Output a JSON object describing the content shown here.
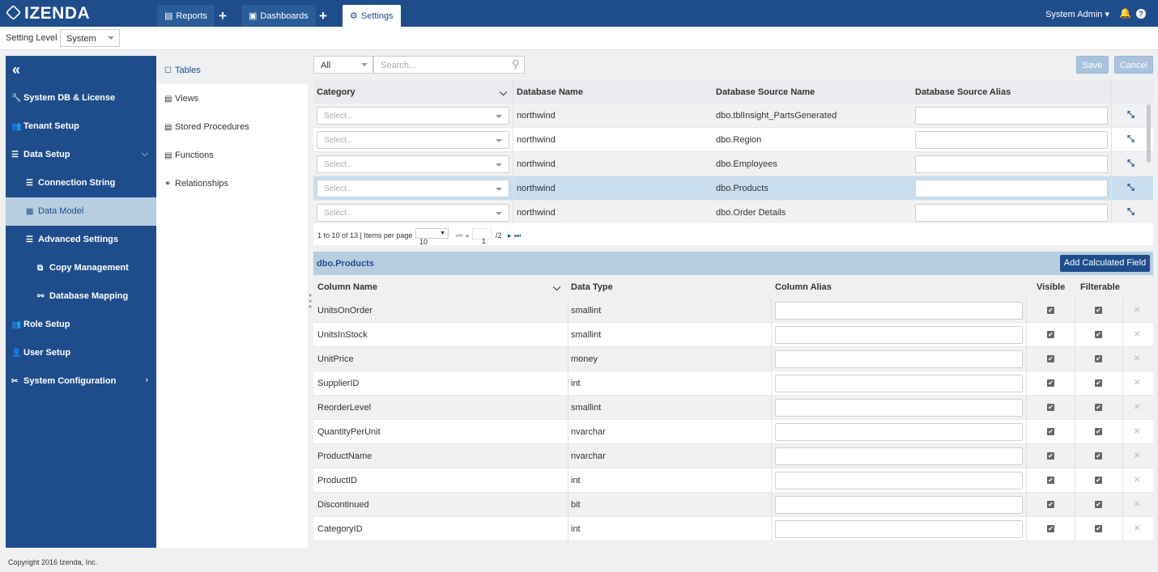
{
  "app": {
    "logo": "IZENDA",
    "tabs": [
      {
        "label": "Reports",
        "icon": "reports-icon"
      },
      {
        "label": "Dashboards",
        "icon": "dashboards-icon"
      },
      {
        "label": "Settings",
        "icon": "gear-icon"
      }
    ],
    "user": "System Admin"
  },
  "setting_level": {
    "label": "Setting Level",
    "value": "System"
  },
  "sidebar": {
    "items": [
      {
        "label": "System DB & License",
        "icon": "wrench-icon"
      },
      {
        "label": "Tenant Setup",
        "icon": "users-icon"
      },
      {
        "label": "Data Setup",
        "icon": "data-setup-icon"
      },
      {
        "label": "Connection String",
        "icon": "connection-icon"
      },
      {
        "label": "Data Model",
        "icon": "grid-icon"
      },
      {
        "label": "Advanced Settings",
        "icon": "advanced-icon"
      },
      {
        "label": "Copy Management",
        "icon": "copy-icon"
      },
      {
        "label": "Database Mapping",
        "icon": "mapping-icon"
      },
      {
        "label": "Role Setup",
        "icon": "users-icon"
      },
      {
        "label": "User Setup",
        "icon": "user-icon"
      },
      {
        "label": "System Configuration",
        "icon": "tools-icon"
      }
    ]
  },
  "subnav": {
    "items": [
      {
        "label": "Tables",
        "icon": "table-icon"
      },
      {
        "label": "Views",
        "icon": "view-icon"
      },
      {
        "label": "Stored Procedures",
        "icon": "procedure-icon"
      },
      {
        "label": "Functions",
        "icon": "function-icon"
      },
      {
        "label": "Relationships",
        "icon": "link-icon"
      }
    ]
  },
  "toolbar": {
    "filter_value": "All",
    "search_placeholder": "Search...",
    "save": "Save",
    "cancel": "Cancel"
  },
  "tables_grid": {
    "headers": [
      "Category",
      "Database Name",
      "Database Source Name",
      "Database Source Alias"
    ],
    "category_placeholder": "Select...",
    "rows": [
      {
        "database": "northwind",
        "source": "dbo.tblInsight_PartsGenerated",
        "alias": ""
      },
      {
        "database": "northwind",
        "source": "dbo.Region",
        "alias": ""
      },
      {
        "database": "northwind",
        "source": "dbo.Employees",
        "alias": ""
      },
      {
        "database": "northwind",
        "source": "dbo.Products",
        "alias": ""
      },
      {
        "database": "northwind",
        "source": "dbo.Order Details",
        "alias": ""
      }
    ]
  },
  "pager": {
    "summary": "1 to 10 of 13 | Items per page",
    "page_size": "10",
    "page": "1",
    "total": "/2"
  },
  "detail": {
    "title": "dbo.Products",
    "add_button": "Add Calculated Field",
    "headers": [
      "Column Name",
      "Data Type",
      "Column Alias",
      "Visible",
      "Filterable"
    ],
    "rows": [
      {
        "name": "UnitsOnOrder",
        "type": "smallint"
      },
      {
        "name": "UnitsInStock",
        "type": "smallint"
      },
      {
        "name": "UnitPrice",
        "type": "money"
      },
      {
        "name": "SupplierID",
        "type": "int"
      },
      {
        "name": "ReorderLevel",
        "type": "smallint"
      },
      {
        "name": "QuantityPerUnit",
        "type": "nvarchar"
      },
      {
        "name": "ProductName",
        "type": "nvarchar"
      },
      {
        "name": "ProductID",
        "type": "int"
      },
      {
        "name": "Discontinued",
        "type": "bit"
      },
      {
        "name": "CategoryID",
        "type": "int"
      }
    ]
  },
  "footer": {
    "copyright": "Copyright 2016 Izenda, Inc."
  },
  "colors": {
    "brand": "#1f4d8b",
    "active_row": "#c9dff0",
    "sidebar_active": "#b8cde0"
  }
}
